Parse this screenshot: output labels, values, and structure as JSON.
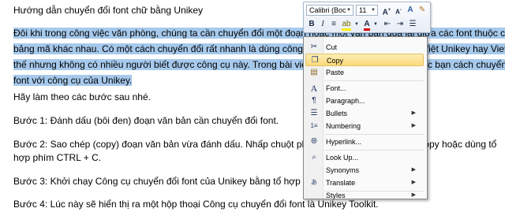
{
  "document": {
    "title": "Hướng dẫn chuyển đổi font chữ bằng Unikey",
    "paragraph_lines": [
      "Đôi khi trong công việc văn phòng, chúng ta cần chuyển đổi một đoạn hoặc một văn bản qua lại giữa các font thuộc các",
      "bảng mã khác nhau. Có một cách chuyển đổi rất nhanh là dùng công cụ có sẵn trong bộ gõ tiếng Việt Unikey hay Vietkey,",
      "thế nhưng không có nhiều người biết được công cụ này. Trong bài viết này, mình sẽ hướng dẫn các bạn cách chuyển đổi",
      "font với công cụ của Unikey."
    ],
    "intro": "Hãy làm theo các bước sau nhé.",
    "step1": "Bước 1: Đánh dấu (bôi đen) đoạn văn bản cần chuyển đổi font.",
    "step2_line1": "Bước 2: Sao chép (copy) đoạn văn bản vừa đánh dấu. Nhấp chuột phải vào vùng chọn và chọn Copy hoặc dùng tổ",
    "step2_line2": "hợp phím CTRL + C.",
    "step3": "Bước 3: Khởi chạy Công cụ chuyển đổi font của Unikey bằng tổ hợp phím CTRL + SHIFT + F6.",
    "step4": "Bước 4: Lúc này sẽ hiển thị ra một hộp thoại Công cụ chuyển đổi font là Unikey Toolkit."
  },
  "mini_toolbar": {
    "font_name": "Calibri (Boc",
    "font_size": "11"
  },
  "context_menu": {
    "items": [
      {
        "label": "Cut",
        "icon": "scissors-icon"
      },
      {
        "label": "Copy",
        "icon": "copy-icon"
      },
      {
        "label": "Paste",
        "icon": "paste-icon"
      },
      {
        "label": "Font...",
        "icon": "font-icon"
      },
      {
        "label": "Paragraph...",
        "icon": "paragraph-icon"
      },
      {
        "label": "Bullets",
        "icon": "bullets-icon"
      },
      {
        "label": "Numbering",
        "icon": "numbering-icon"
      },
      {
        "label": "Hyperlink...",
        "icon": "hyperlink-icon"
      },
      {
        "label": "Look Up...",
        "icon": "lookup-icon"
      },
      {
        "label": "Synonyms",
        "icon": ""
      },
      {
        "label": "Translate",
        "icon": "translate-icon"
      },
      {
        "label": "Styles",
        "icon": ""
      }
    ],
    "highlighted": "Copy"
  },
  "colors": {
    "selection": "#a6c9ec",
    "menu_highlight": "#fbd97a"
  }
}
